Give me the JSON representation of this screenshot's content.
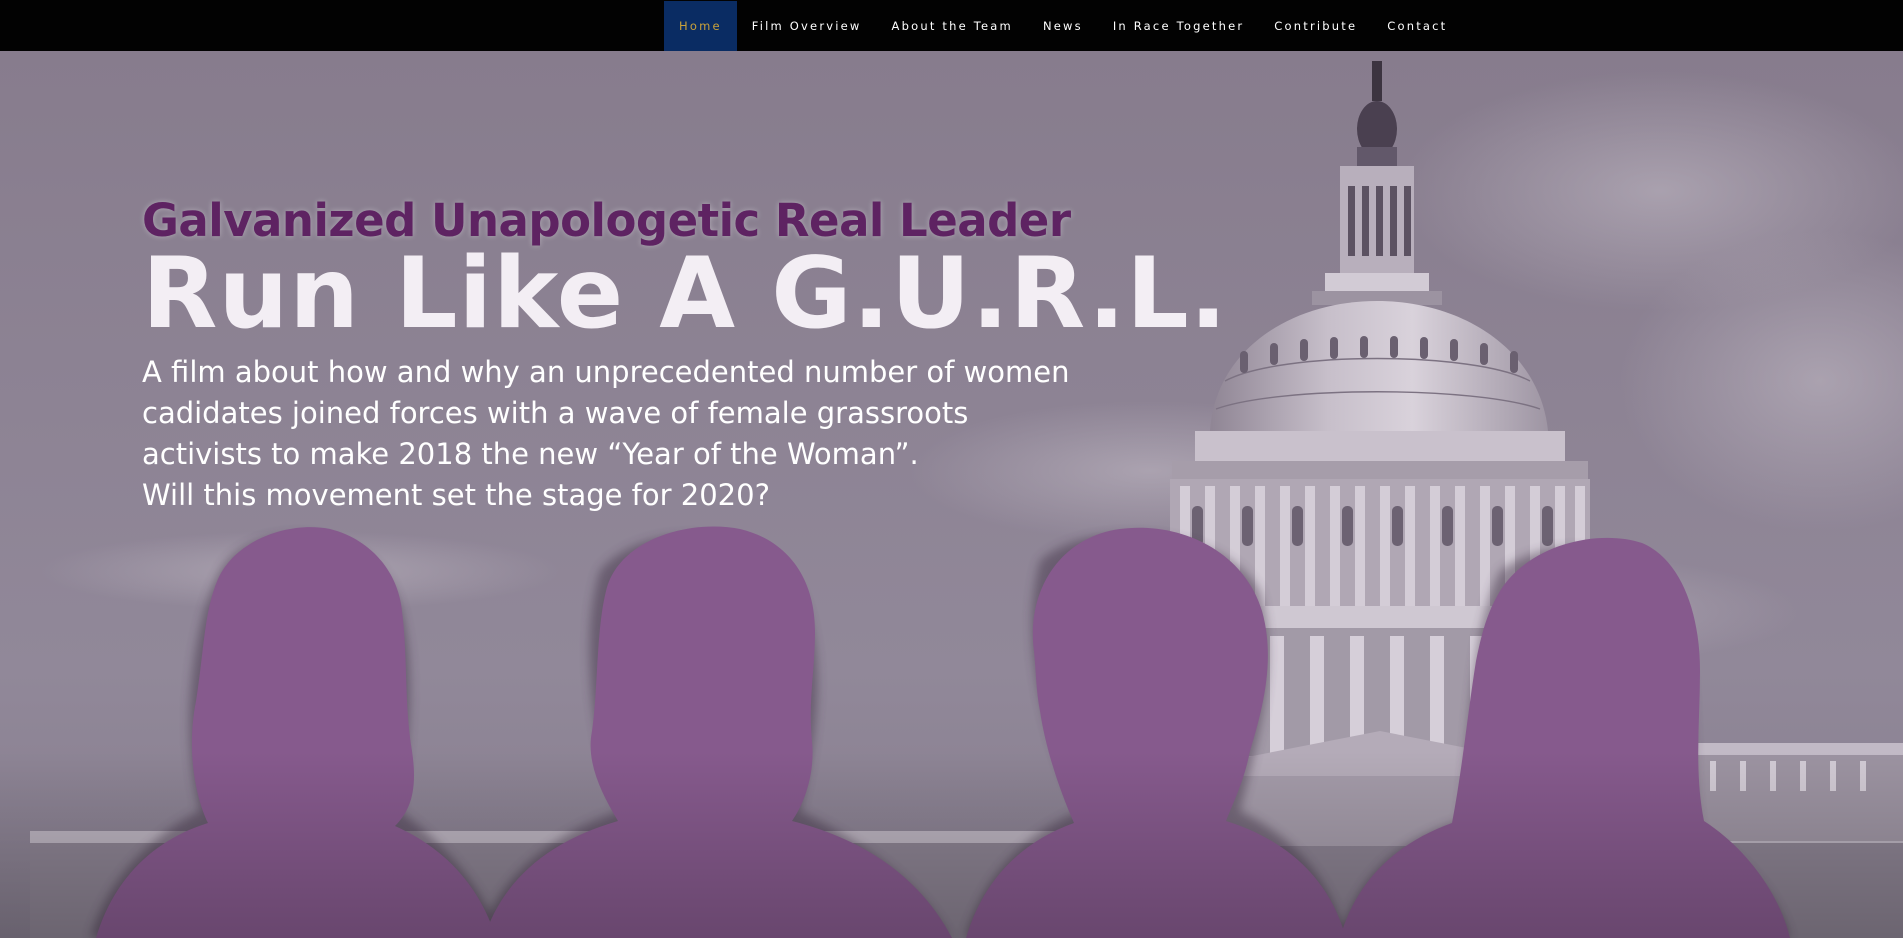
{
  "nav": {
    "items": [
      {
        "label": "Home",
        "active": true
      },
      {
        "label": "Film Overview",
        "active": false
      },
      {
        "label": "About the Team",
        "active": false
      },
      {
        "label": "News",
        "active": false
      },
      {
        "label": "In Race Together",
        "active": false
      },
      {
        "label": "Contribute",
        "active": false
      },
      {
        "label": "Contact",
        "active": false
      }
    ]
  },
  "hero": {
    "tagline": "Galvanized Unapologetic Real Leader",
    "title": "Run Like A G.U.R.L.",
    "description_lines": [
      "A film about how and why an unprecedented number of women",
      "cadidates joined forces with a wave of female grassroots",
      "activists to make 2018 the new “Year of the Woman”.",
      "Will this movement set the stage for 2020?"
    ]
  },
  "colors": {
    "nav_background": "#020202",
    "nav_active_background": "#0a2c63",
    "nav_active_text": "#c9a13a",
    "tagline": "#5e2362",
    "silhouette": "#865a8d",
    "hero_overlay": "#8d8394"
  },
  "icons": {
    "background_image": "us-capitol-building",
    "foreground_image": "women-silhouettes"
  }
}
